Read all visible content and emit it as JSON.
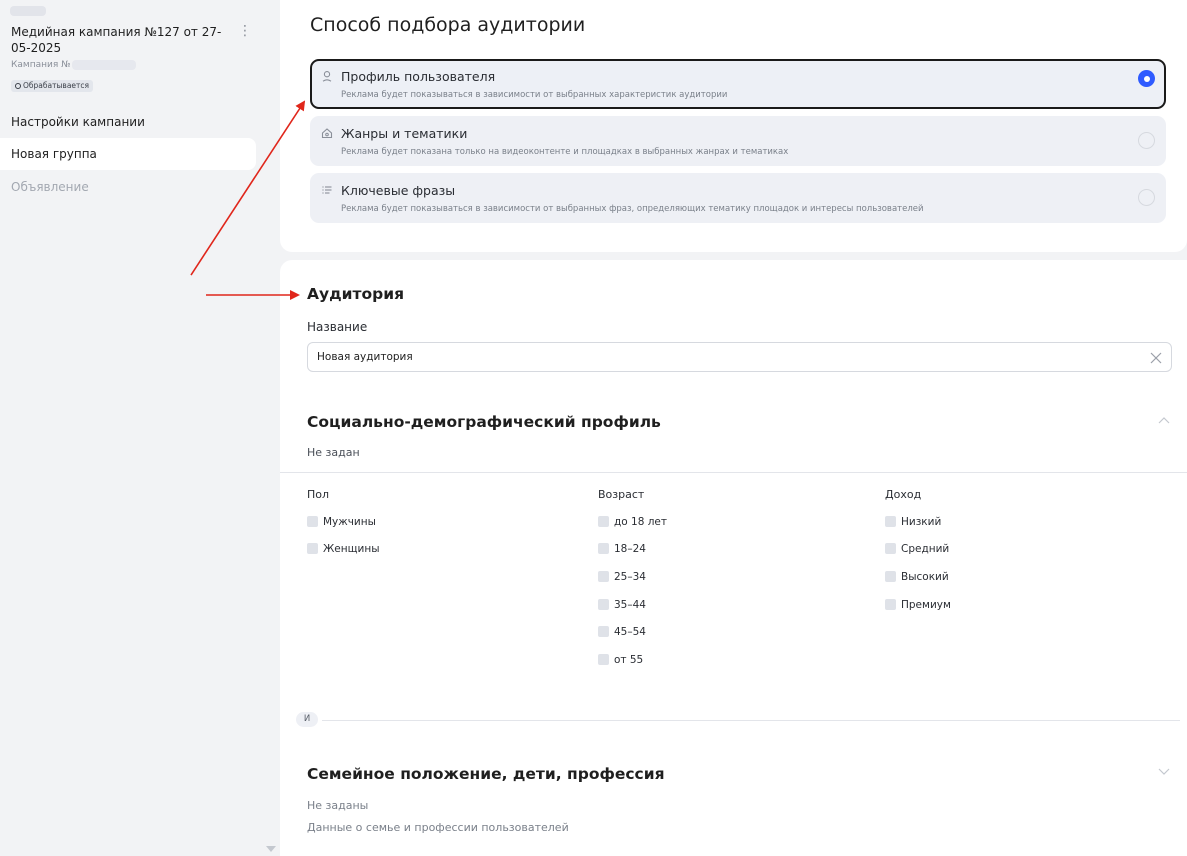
{
  "sidebar": {
    "campaign_title": "Медийная кампания №127 от 27-05-2025",
    "campaign_number_label": "Кампания №",
    "status": "Обрабатывается",
    "menu_icon": "more-vertical-icon",
    "items": [
      {
        "label": "Настройки кампании",
        "state": "normal"
      },
      {
        "label": "Новая группа",
        "state": "active"
      },
      {
        "label": "Объявление",
        "state": "disabled"
      }
    ]
  },
  "targeting": {
    "title": "Способ подбора аудитории",
    "options": [
      {
        "title": "Профиль пользователя",
        "desc": "Реклама будет показываться в зависимости от выбранных характеристик аудитории",
        "icon": "user-icon",
        "selected": true
      },
      {
        "title": "Жанры и тематики",
        "desc": "Реклама будет показана только на видеоконтенте и площадках в выбранных жанрах и тематиках",
        "icon": "genres-icon",
        "selected": false
      },
      {
        "title": "Ключевые фразы",
        "desc": "Реклама будет показываться в зависимости от выбранных фраз, определяющих тематику площадок и интересы пользователей",
        "icon": "list-icon",
        "selected": false
      }
    ]
  },
  "audience": {
    "title": "Аудитория",
    "name_label": "Название",
    "name_value": "Новая аудитория"
  },
  "socio_demo": {
    "title": "Социально-демографический профиль",
    "subtitle": "Не задан",
    "gender": {
      "header": "Пол",
      "options": [
        "Мужчины",
        "Женщины"
      ]
    },
    "age": {
      "header": "Возраст",
      "options": [
        "до 18 лет",
        "18–24",
        "25–34",
        "35–44",
        "45–54",
        "от 55"
      ]
    },
    "income": {
      "header": "Доход",
      "options": [
        "Низкий",
        "Средний",
        "Высокий",
        "Премиум"
      ]
    }
  },
  "and_label": "И",
  "family": {
    "title": "Семейное положение, дети, профессия",
    "subtitle": "Не заданы",
    "description": "Данные о семье и профессии пользователей"
  },
  "colors": {
    "accent": "#2f5bff",
    "annotation_arrow": "#e0261b"
  }
}
